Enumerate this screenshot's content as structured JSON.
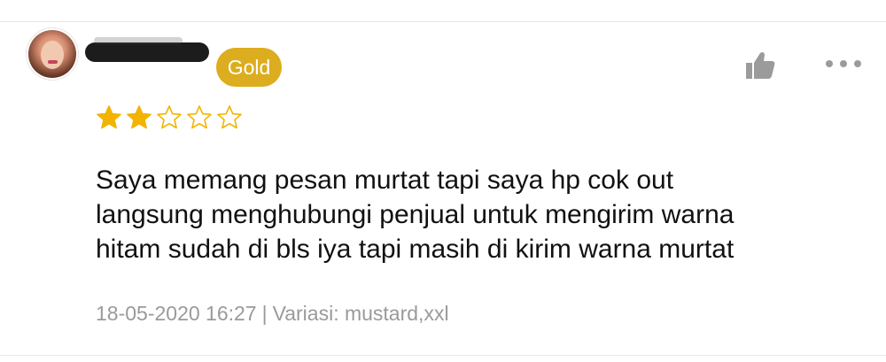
{
  "review": {
    "badge": "Gold",
    "rating": 2,
    "rating_max": 5,
    "text": "Saya memang pesan murtat tapi saya hp cok out\nlangsung menghubungi penjual untuk mengirim warna\nhitam sudah di bls iya tapi masih di kirim warna murtat",
    "datetime": "18-05-2020 16:27",
    "separator": "|",
    "variant": "Variasi: mustard,xxl"
  },
  "icons": {
    "like": "thumbs-up-icon",
    "more": "more-dots-icon",
    "star_filled": "star-filled-icon",
    "star_empty": "star-outline-icon"
  },
  "colors": {
    "badge_bg": "#dcad1f",
    "star": "#f2b400",
    "meta_text": "#9a9a9a",
    "icon_gray": "#9b9b9b"
  }
}
